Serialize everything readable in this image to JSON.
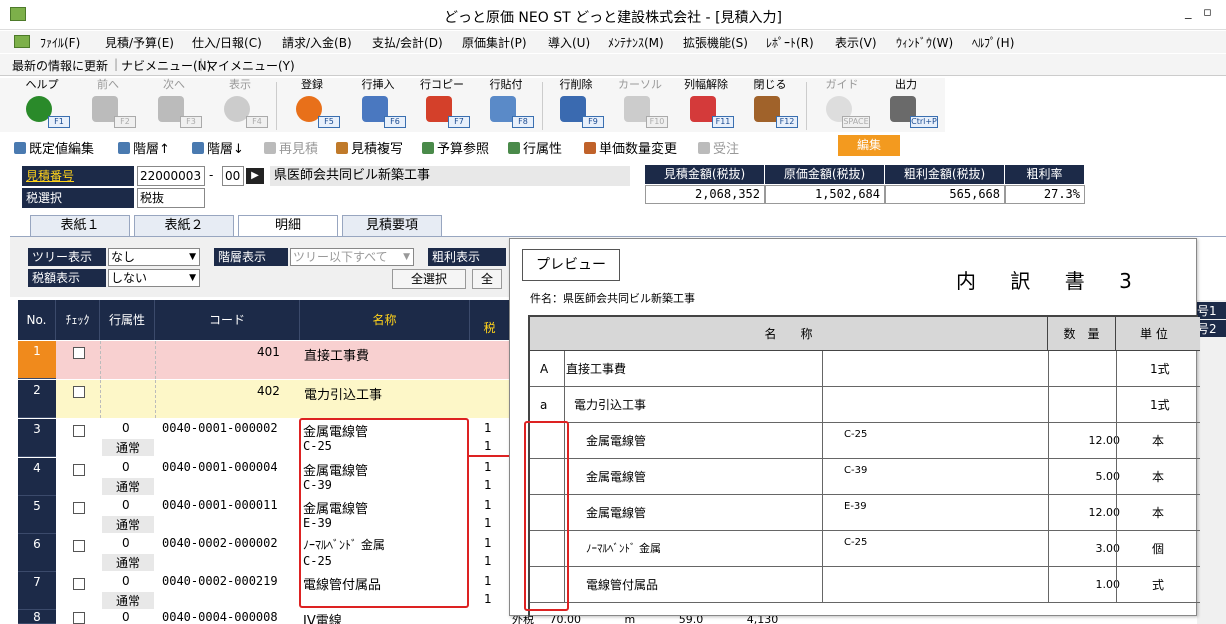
{
  "window": {
    "title": "どっと原価 NEO ST どっと建設株式会社 - [見積入力]",
    "min": "_",
    "restore": "▫",
    "close": "×"
  },
  "menu": [
    "ﾌｧｲﾙ(F)",
    "見積/予算(E)",
    "仕入/日報(C)",
    "請求/入金(B)",
    "支払/会計(D)",
    "原価集計(P)",
    "導入(U)",
    "ﾒﾝﾃﾅﾝｽ(M)",
    "拡張機能(S)",
    "ﾚﾎﾟｰﾄ(R)",
    "表示(V)",
    "ｳｨﾝﾄﾞｳ(W)",
    "ﾍﾙﾌﾟ(H)"
  ],
  "menu2": [
    "最新の情報に更新",
    "ナビメニュー(N)",
    "マイメニュー(Y)"
  ],
  "toolbar": [
    {
      "label": "ヘルプ",
      "key": "F1",
      "icon": "help-icon",
      "color": "#2a8a2a",
      "enabled": true
    },
    {
      "label": "前へ",
      "key": "F2",
      "icon": "back-arrow-icon",
      "color": "#bbbbbb",
      "enabled": false
    },
    {
      "label": "次へ",
      "key": "F3",
      "icon": "forward-arrow-icon",
      "color": "#bbbbbb",
      "enabled": false
    },
    {
      "label": "表示",
      "key": "F4",
      "icon": "magnifier-icon",
      "color": "#cccccc",
      "enabled": false
    },
    {
      "label": "登録",
      "key": "F5",
      "icon": "ok-icon",
      "color": "#e8701a",
      "enabled": true
    },
    {
      "label": "行挿入",
      "key": "F6",
      "icon": "row-insert-icon",
      "color": "#4a78c0",
      "enabled": true
    },
    {
      "label": "行コピー",
      "key": "F7",
      "icon": "row-copy-icon",
      "color": "#d4402a",
      "enabled": true
    },
    {
      "label": "行貼付",
      "key": "F8",
      "icon": "row-paste-icon",
      "color": "#5a8ac8",
      "enabled": true
    },
    {
      "label": "行削除",
      "key": "F9",
      "icon": "row-delete-icon",
      "color": "#3a6ab0",
      "enabled": true
    },
    {
      "label": "カーソル",
      "key": "F10",
      "icon": "cursor-icon",
      "color": "#cccccc",
      "enabled": false
    },
    {
      "label": "列幅解除",
      "key": "F11",
      "icon": "column-width-icon",
      "color": "#d43a3a",
      "enabled": true
    },
    {
      "label": "閉じる",
      "key": "F12",
      "icon": "door-close-icon",
      "color": "#a0622a",
      "enabled": true
    },
    {
      "label": "ガイド",
      "key": "SPACE",
      "icon": "lightbulb-icon",
      "color": "#dddddd",
      "enabled": false
    },
    {
      "label": "出力",
      "key": "Ctrl+P",
      "icon": "printer-icon",
      "color": "#6a6a6a",
      "enabled": true
    }
  ],
  "toolbar2": [
    {
      "label": "既定値編集",
      "color": "#4a7ab0",
      "enabled": true
    },
    {
      "label": "階層↑",
      "color": "#4a7ab0",
      "enabled": true
    },
    {
      "label": "階層↓",
      "color": "#4a7ab0",
      "enabled": true
    },
    {
      "label": "再見積",
      "color": "#bbbbbb",
      "enabled": false
    },
    {
      "label": "見積複写",
      "color": "#c07a2a",
      "enabled": true
    },
    {
      "label": "予算参照",
      "color": "#4a8a4a",
      "enabled": true
    },
    {
      "label": "行属性",
      "color": "#4a8a4a",
      "enabled": true
    },
    {
      "label": "単価数量変更",
      "color": "#c0622a",
      "enabled": true
    },
    {
      "label": "受注",
      "color": "#bbbbbb",
      "enabled": false
    }
  ],
  "edit_button": "編集",
  "header": {
    "estimate_no_label": "見積番号",
    "estimate_no": "22000003",
    "dash": "-",
    "branch": "00",
    "jump": "▶",
    "project": "県医師会共同ビル新築工事",
    "tax_label": "税選択",
    "tax_value": "税抜"
  },
  "summary": {
    "headers": [
      "見積金額(税抜)",
      "原価金額(税抜)",
      "粗利金額(税抜)",
      "粗利率"
    ],
    "values": [
      "2,068,352",
      "1,502,684",
      "565,668",
      "27.3%"
    ]
  },
  "tabs": [
    "表紙１",
    "表紙２",
    "明細",
    "見積要項"
  ],
  "filters": {
    "tree_label": "ツリー表示",
    "tree_value": "なし",
    "tax_label": "税額表示",
    "tax_value": "しない",
    "level_label": "階層表示",
    "level_value": "ツリー以下すべて",
    "profit_label": "粗利表示",
    "select_all": "全選択",
    "next_btn": "全"
  },
  "grid": {
    "headers": [
      "No.",
      "ﾁｪｯｸ",
      "行属性",
      "コード",
      "名称",
      "税"
    ],
    "rows": [
      {
        "no": "1",
        "attr": "",
        "attr2": "",
        "code": "401",
        "name1": "直接工事費",
        "name2": "",
        "qty1": "",
        "qty2": ""
      },
      {
        "no": "2",
        "attr": "",
        "attr2": "",
        "code": "402",
        "name1": "電力引込工事",
        "name2": "",
        "qty1": "",
        "qty2": ""
      },
      {
        "no": "3",
        "attr": "0",
        "attr2": "通常",
        "code": "0040-0001-000002",
        "name1": "金属電線管",
        "name2": "C-25",
        "qty1": "1",
        "qty2": "1"
      },
      {
        "no": "4",
        "attr": "0",
        "attr2": "通常",
        "code": "0040-0001-000004",
        "name1": "金属電線管",
        "name2": "C-39",
        "qty1": "1",
        "qty2": "1"
      },
      {
        "no": "5",
        "attr": "0",
        "attr2": "通常",
        "code": "0040-0001-000011",
        "name1": "金属電線管",
        "name2": "E-39",
        "qty1": "1",
        "qty2": "1"
      },
      {
        "no": "6",
        "attr": "0",
        "attr2": "通常",
        "code": "0040-0002-000002",
        "name1": "ﾉｰﾏﾙﾍﾞﾝﾄﾞ 金属",
        "name2": "C-25",
        "qty1": "1",
        "qty2": "1"
      },
      {
        "no": "7",
        "attr": "0",
        "attr2": "通常",
        "code": "0040-0002-000219",
        "name1": "電線管付属品",
        "name2": "",
        "qty1": "1",
        "qty2": "1"
      },
      {
        "no": "8",
        "attr": "0",
        "attr2": "",
        "code": "0040-0004-000008",
        "name1": "IV電線",
        "name2": "",
        "qty1": "",
        "qty2": ""
      }
    ],
    "bottom_extra": [
      "外税",
      "70.00",
      "m",
      "59.0",
      "4,130"
    ]
  },
  "preview": {
    "label": "プレビュー",
    "title": "内 訳 書 3",
    "subject": "件名：県医師会共同ビル新築工事",
    "headers": [
      "名　　称",
      "数　量",
      "単 位"
    ],
    "rows": [
      {
        "mark": "A",
        "name": "直接工事費",
        "spec": "",
        "qty": "",
        "unit": "1式"
      },
      {
        "mark": "a",
        "name": "電力引込工事",
        "spec": "",
        "qty": "",
        "unit": "1式"
      },
      {
        "mark": "",
        "name": "金属電線管",
        "spec": "C-25",
        "qty": "12.00",
        "unit": "本"
      },
      {
        "mark": "",
        "name": "金属電線管",
        "spec": "C-39",
        "qty": "5.00",
        "unit": "本"
      },
      {
        "mark": "",
        "name": "金属電線管",
        "spec": "E-39",
        "qty": "12.00",
        "unit": "本"
      },
      {
        "mark": "",
        "name": "ﾉｰﾏﾙﾍﾞﾝﾄﾞ 金属",
        "spec": "C-25",
        "qty": "3.00",
        "unit": "個"
      },
      {
        "mark": "",
        "name": "電線管付属品",
        "spec": "",
        "qty": "1.00",
        "unit": "式"
      }
    ]
  },
  "right_labels": [
    "号1",
    "号2"
  ]
}
